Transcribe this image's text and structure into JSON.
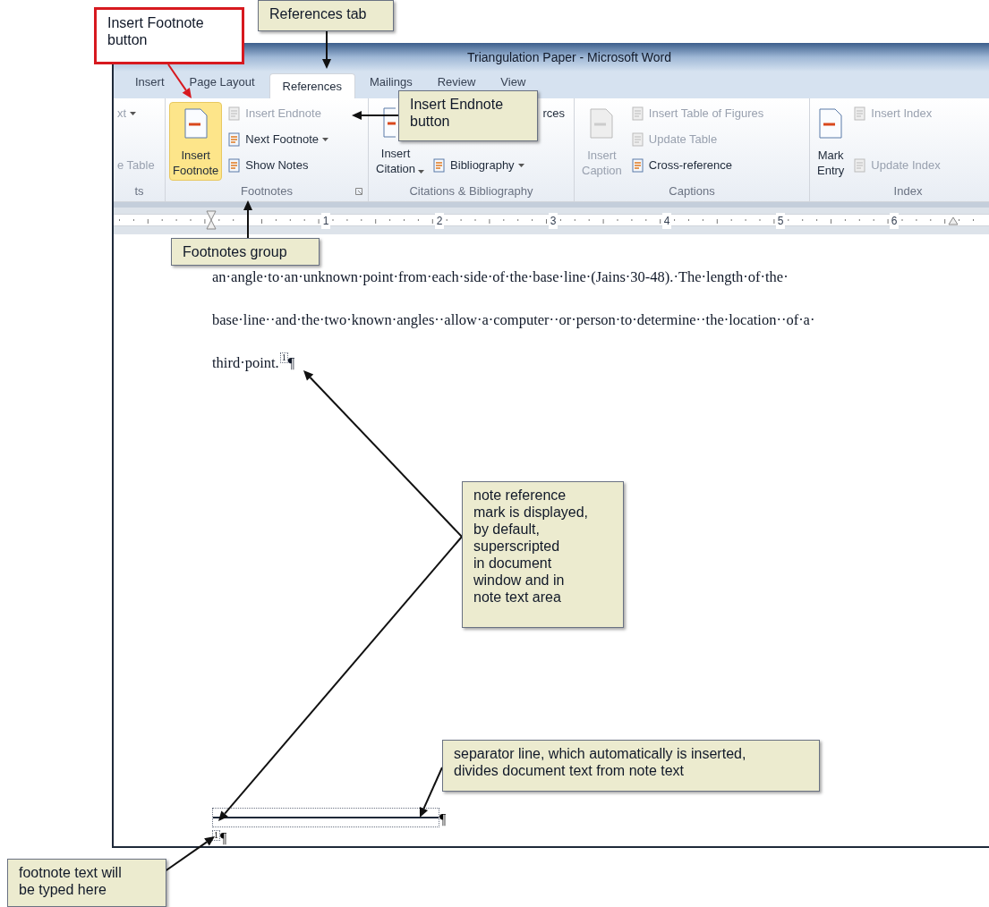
{
  "window": {
    "title": "Triangulation Paper - Microsoft Word"
  },
  "tabs": [
    {
      "label": "Insert",
      "selected": false
    },
    {
      "label": "Page Layout",
      "selected": false
    },
    {
      "label": "References",
      "selected": true
    },
    {
      "label": "Mailings",
      "selected": false
    },
    {
      "label": "Review",
      "selected": false
    },
    {
      "label": "View",
      "selected": false
    }
  ],
  "ribbon": {
    "groups": [
      {
        "label": "ts",
        "commands": [
          {
            "kind": "small",
            "label": "xt",
            "disabled": true,
            "dropdown": true
          },
          {
            "kind": "small",
            "label": "e Table",
            "disabled": true,
            "dropdown": false
          }
        ]
      },
      {
        "label": "Footnotes",
        "launcher": true,
        "commands": [
          {
            "kind": "large",
            "label": "Insert\nFootnote",
            "disabled": false,
            "dropdown": false,
            "selected": true
          },
          {
            "kind": "small",
            "label": "Insert Endnote",
            "disabled": true,
            "dropdown": false
          },
          {
            "kind": "small",
            "label": "Next Footnote",
            "disabled": false,
            "dropdown": true
          },
          {
            "kind": "small",
            "label": "Show Notes",
            "disabled": false,
            "dropdown": false
          }
        ]
      },
      {
        "label": "Citations & Bibliography",
        "commands": [
          {
            "kind": "large",
            "label": "Insert\nCitation",
            "disabled": false,
            "dropdown": true,
            "selected": false
          },
          {
            "kind": "fragment",
            "label": "rces",
            "disabled": false,
            "dropdown": false
          },
          {
            "kind": "small",
            "label": "Bibliography",
            "disabled": false,
            "dropdown": true
          }
        ]
      },
      {
        "label": "Captions",
        "commands": [
          {
            "kind": "large",
            "label": "Insert\nCaption",
            "disabled": true,
            "dropdown": false,
            "selected": false
          },
          {
            "kind": "small",
            "label": "Insert Table of Figures",
            "disabled": true,
            "dropdown": false
          },
          {
            "kind": "small",
            "label": "Update Table",
            "disabled": true,
            "dropdown": false
          },
          {
            "kind": "small",
            "label": "Cross-reference",
            "disabled": false,
            "dropdown": false
          }
        ]
      },
      {
        "label": "Index",
        "commands": [
          {
            "kind": "large",
            "label": "Mark\nEntry",
            "disabled": false,
            "dropdown": false,
            "selected": false
          },
          {
            "kind": "small",
            "label": "Insert Index",
            "disabled": true,
            "dropdown": false
          },
          {
            "kind": "small",
            "label": "Update Index",
            "disabled": true,
            "dropdown": false
          }
        ]
      }
    ]
  },
  "ruler": {
    "numbers": [
      "1",
      "2",
      "3",
      "4",
      "5",
      "6"
    ]
  },
  "document": {
    "lines": [
      "an·angle·to·an·unknown·point·from·each·side·of·the·base·line·(Jains·30-48).·The·length·of·the·",
      "base·line··and·the·two·known·angles··allow·a·computer··or·person·to·determine··the·location··of·a·",
      "third·point."
    ],
    "note_mark": "1",
    "pilcrow": "¶",
    "footnote": {
      "mark": "1",
      "pilcrow": "¶",
      "separator_pilcrow": "¶"
    }
  },
  "callouts": [
    {
      "kind": "highlight",
      "text": "Insert Footnote\nbutton"
    },
    {
      "kind": "note",
      "text": "References tab"
    },
    {
      "kind": "note",
      "text": "Insert Endnote\nbutton"
    },
    {
      "kind": "note",
      "text": "Footnotes group"
    },
    {
      "kind": "note",
      "text": "note reference\nmark is displayed,\nby default,\nsuperscripted\nin document\nwindow and in\nnote text area"
    },
    {
      "kind": "note",
      "text": "separator line, which automatically is inserted,\ndivides document text from note text"
    },
    {
      "kind": "note",
      "text": "footnote text will\nbe typed here"
    }
  ]
}
